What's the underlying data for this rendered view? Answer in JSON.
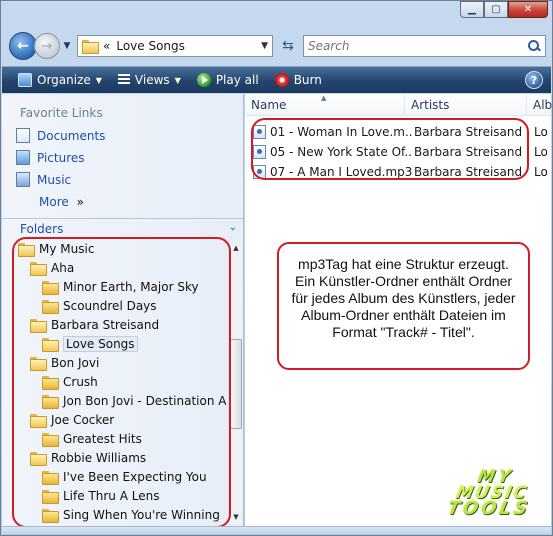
{
  "address": {
    "path_prefix": "«",
    "current": "Love Songs"
  },
  "search": {
    "placeholder": "Search"
  },
  "toolbar": {
    "organize": "Organize",
    "views": "Views",
    "play_all": "Play all",
    "burn": "Burn",
    "help": "?"
  },
  "nav": {
    "favorite_links_title": "Favorite Links",
    "favorites": [
      "Documents",
      "Pictures",
      "Music"
    ],
    "more": "More",
    "more_arrow": "»",
    "folders_title": "Folders"
  },
  "tree": [
    {
      "label": "My Music",
      "level": 0,
      "open": true
    },
    {
      "label": "Aha",
      "level": 1,
      "open": true
    },
    {
      "label": "Minor Earth, Major Sky",
      "level": 2
    },
    {
      "label": "Scoundrel Days",
      "level": 2
    },
    {
      "label": "Barbara Streisand",
      "level": 1,
      "open": true
    },
    {
      "label": "Love Songs",
      "level": 2,
      "selected": true,
      "open": true
    },
    {
      "label": "Bon Jovi",
      "level": 1,
      "open": true
    },
    {
      "label": "Crush",
      "level": 2
    },
    {
      "label": "Jon Bon Jovi - Destination An",
      "level": 2
    },
    {
      "label": "Joe Cocker",
      "level": 1,
      "open": true
    },
    {
      "label": "Greatest Hits",
      "level": 2
    },
    {
      "label": "Robbie Williams",
      "level": 1,
      "open": true
    },
    {
      "label": "I've Been Expecting You",
      "level": 2
    },
    {
      "label": "Life Thru A Lens",
      "level": 2
    },
    {
      "label": "Sing When You're Winning",
      "level": 2
    }
  ],
  "columns": {
    "name": "Name",
    "artists": "Artists",
    "album": "Alb"
  },
  "files": [
    {
      "name": "01 - Woman In Love.m...",
      "artist": "Barbara Streisand",
      "album": "Lo"
    },
    {
      "name": "05 - New York State Of...",
      "artist": "Barbara Streisand",
      "album": "Lo"
    },
    {
      "name": "07 - A Man I Loved.mp3",
      "artist": "Barbara Streisand",
      "album": "Lo"
    }
  ],
  "callout": "mp3Tag hat eine Struktur erzeugt. Ein Künstler-Ordner enthält Ordner für jedes Album des Künstlers, jeder Album-Ordner enthält Dateien im Format \"Track# - Titel\".",
  "logo": {
    "line1": "MY",
    "line2": "MUSIC",
    "line3": "TOOLS"
  }
}
